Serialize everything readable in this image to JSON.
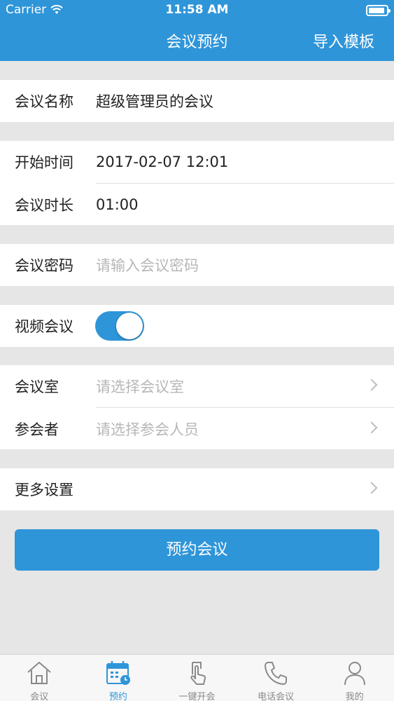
{
  "status_bar": {
    "carrier": "Carrier",
    "time": "11:58 AM"
  },
  "nav": {
    "title": "会议预约",
    "action": "导入模板"
  },
  "form": {
    "meeting_name": {
      "label": "会议名称",
      "value": "超级管理员的会议"
    },
    "start_time": {
      "label": "开始时间",
      "value": "2017-02-07 12:01"
    },
    "duration": {
      "label": "会议时长",
      "value": "01:00"
    },
    "password": {
      "label": "会议密码",
      "placeholder": "请输入会议密码"
    },
    "video": {
      "label": "视频会议",
      "enabled": true
    },
    "room": {
      "label": "会议室",
      "placeholder": "请选择会议室"
    },
    "participants": {
      "label": "参会者",
      "placeholder": "请选择参会人员"
    },
    "more": {
      "label": "更多设置"
    }
  },
  "submit_label": "预约会议",
  "tabs": [
    {
      "label": "会议",
      "icon": "home-icon",
      "active": false
    },
    {
      "label": "预约",
      "icon": "calendar-icon",
      "active": true
    },
    {
      "label": "一键开会",
      "icon": "tap-icon",
      "active": false
    },
    {
      "label": "电话会议",
      "icon": "phone-icon",
      "active": false
    },
    {
      "label": "我的",
      "icon": "user-icon",
      "active": false
    }
  ],
  "colors": {
    "accent": "#2f95d9",
    "background": "#e6e6e6",
    "placeholder": "#b7b7b7",
    "tab_inactive": "#8a8a8a"
  }
}
